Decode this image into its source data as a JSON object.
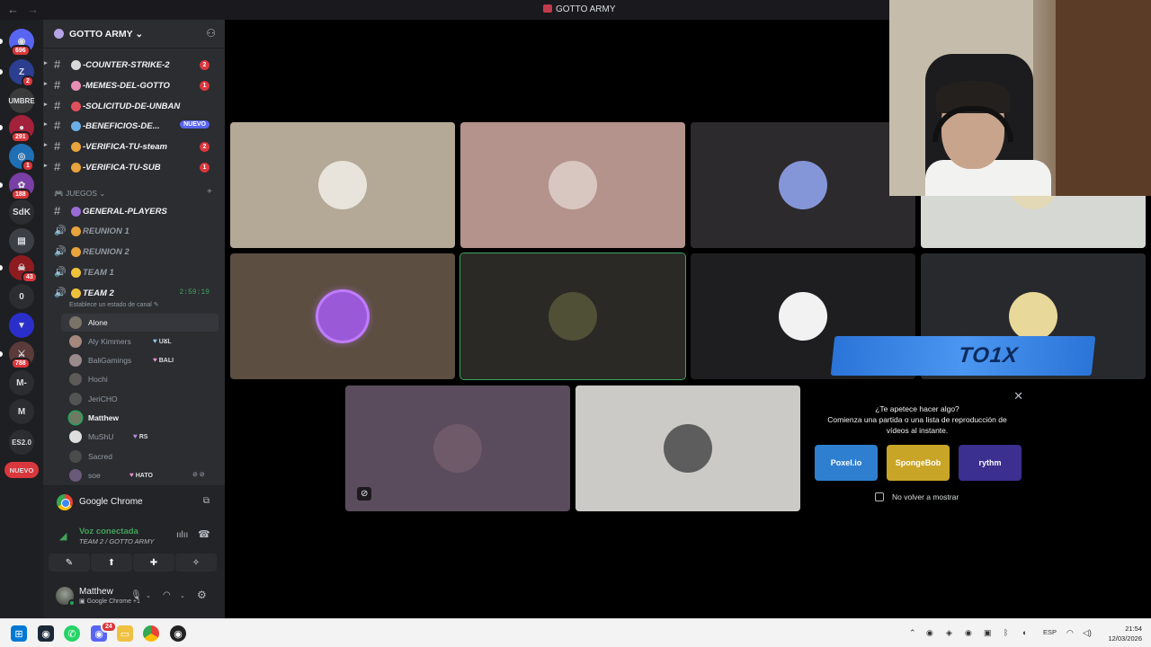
{
  "window": {
    "title": "GOTTO ARMY"
  },
  "rail": {
    "servers": [
      {
        "label": "◉",
        "badge": "696",
        "color": "#5865f2"
      },
      {
        "label": "Z",
        "badge": "2",
        "color": "#2c3e8f"
      },
      {
        "label": "UMBRE",
        "badge": "",
        "color": "#3a3a3a"
      },
      {
        "label": "●",
        "badge": "291",
        "color": "#a3213b"
      },
      {
        "label": "◎",
        "badge": "1",
        "color": "#1f6fb5"
      },
      {
        "label": "✿",
        "badge": "188",
        "color": "#7a3fa6"
      },
      {
        "label": "SdK",
        "badge": "",
        "color": "#2b2d31"
      },
      {
        "label": "▤",
        "badge": "",
        "color": "#3c3f45"
      },
      {
        "label": "☠",
        "badge": "43",
        "color": "#8e1b20"
      },
      {
        "label": "0",
        "badge": "",
        "color": "#2b2d31"
      },
      {
        "label": "▼",
        "badge": "",
        "color": "#2b2fc9"
      },
      {
        "label": "⚔",
        "badge": "788",
        "color": "#5b3a3a"
      },
      {
        "label": "M-",
        "badge": "",
        "color": "#2b2d31"
      },
      {
        "label": "M",
        "badge": "",
        "color": "#2b2d31"
      },
      {
        "label": "ES2.0",
        "badge": "",
        "color": "#2b2d31"
      }
    ],
    "new_label": "NUEVO"
  },
  "guild": {
    "name": "GOTTO ARMY"
  },
  "channels": [
    {
      "name": "-COUNTER-STRIKE-2",
      "count": "2",
      "emoji_color": "#d9d9d9"
    },
    {
      "name": "-MEMES-DEL-GOTTO",
      "count": "1",
      "emoji_color": "#e88fb6"
    },
    {
      "name": "-SOLICITUD-DE-UNBAN",
      "count": "",
      "emoji_color": "#e0505a"
    },
    {
      "name": "-BENEFICIOS-DE...",
      "count": "",
      "emoji_color": "#6ab0e8",
      "nuevo": "NUEVO"
    },
    {
      "name": "-VERIFICA-TU-steam",
      "count": "2",
      "emoji_color": "#e8a33a"
    },
    {
      "name": "-VERIFICA-TU-SUB",
      "count": "1",
      "emoji_color": "#e8a33a"
    }
  ],
  "category": {
    "name": "JUEGOS",
    "add": "+"
  },
  "text_channel_general": {
    "name": "GENERAL-PLAYERS",
    "emoji_color": "#9a6bd8"
  },
  "voice_channels": [
    {
      "name": "REUNION 1",
      "emoji_color": "#e8a33a"
    },
    {
      "name": "REUNION 2",
      "emoji_color": "#e8a33a"
    },
    {
      "name": "TEAM 1",
      "emoji_color": "#f0c23a"
    },
    {
      "name": "TEAM 2",
      "emoji_color": "#f0c23a",
      "timer": "2:59:19",
      "status_hint": "Establece un estado de canal ✎"
    }
  ],
  "members": [
    {
      "name": "Alone",
      "tag": "",
      "highlight": true,
      "avatar": "#7a7468"
    },
    {
      "name": "Aly Kimmers",
      "tag": "ᑌᘜᒪ",
      "heart": "#8ecbe8",
      "avatar": "#a5877d"
    },
    {
      "name": "BaliGamings",
      "tag": "BALI",
      "heart": "#e88fd4",
      "avatar": "#9a8a8a"
    },
    {
      "name": "Hochi",
      "tag": "",
      "avatar": "#5d5a58"
    },
    {
      "name": "JeriCHO",
      "tag": "",
      "avatar": "#545454"
    },
    {
      "name": "Matthew",
      "tag": "",
      "speaking": true,
      "avatar": "#6e7a62"
    },
    {
      "name": "MuShU",
      "tag": "RS",
      "heart": "#b58fe8",
      "avatar": "#dedede"
    },
    {
      "name": "Sacred",
      "tag": "",
      "avatar": "#4b4b4b"
    },
    {
      "name": "soe",
      "tag": "HATO",
      "heart": "#e88fd4",
      "avatar": "#6a5a7a"
    }
  ],
  "screen_share": {
    "app": "Google Chrome"
  },
  "voice_connection": {
    "status": "Voz conectada",
    "location": "TEAM 2 / GOTTO ARMY"
  },
  "user": {
    "name": "Matthew",
    "activity": "Google Chrome +1"
  },
  "tiles": [
    {
      "bg": "#b4a996",
      "avatar": "#e8e4dc"
    },
    {
      "bg": "#b4938c",
      "avatar": "#d8c6c1"
    },
    {
      "bg": "#2c2a2c",
      "avatar": "#8596d8"
    },
    {
      "bg": "#d5d8d3",
      "avatar": "#e3d9b6"
    },
    {
      "bg": "#5c4e41",
      "avatar": "#9a5ad8"
    },
    {
      "bg": "#2a2926",
      "avatar": "#4f5035"
    },
    {
      "bg": "#1e1e20",
      "avatar": "#f2f2f2"
    },
    {
      "bg": "#28292d",
      "avatar": "#e8d89a"
    },
    {
      "bg": "#5a4c5d",
      "avatar": "#6f5a6a"
    },
    {
      "bg": "#cbcac7",
      "avatar": "#5d5d5d"
    }
  ],
  "banner": {
    "text": "TO1X"
  },
  "promo": {
    "question": "¿Te apetece hacer algo?",
    "subtitle": "Comienza una partida o una lista de reproducción de vídeos al instante.",
    "games": [
      {
        "name": "Poxel.io",
        "color": "#2f7fd1"
      },
      {
        "name": "SpongeBob",
        "color": "#c8a527"
      },
      {
        "name": "rythm",
        "color": "#3b2f8f"
      }
    ],
    "dont_show": "No volver a mostrar"
  },
  "taskbar": {
    "lang": "ESP",
    "time": "21:54",
    "date": "12/03/2026",
    "discord_badge": "24"
  }
}
